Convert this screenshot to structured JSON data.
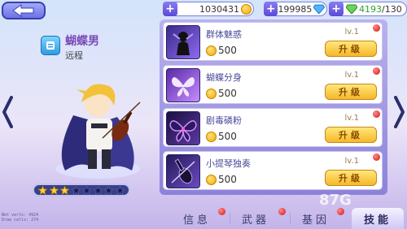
{
  "resources": {
    "coins": "1030431",
    "diamonds": "199985",
    "stamina": "4193",
    "stamina_max": "/130"
  },
  "hero": {
    "name": "蝴蝶男",
    "type": "远程",
    "stars_filled": 3,
    "stars_total": 8
  },
  "skills": [
    {
      "name": "群体魅惑",
      "cost": "500",
      "level": "lv.1",
      "button": "升级",
      "icon": "silhouette-icon"
    },
    {
      "name": "蝴蝶分身",
      "cost": "500",
      "level": "lv.1",
      "button": "升级",
      "icon": "butterfly-icon"
    },
    {
      "name": "剧毒磷粉",
      "cost": "500",
      "level": "lv.1",
      "button": "升级",
      "icon": "poison-butterfly-icon"
    },
    {
      "name": "小提琴独奏",
      "cost": "500",
      "level": "lv.1",
      "button": "升级",
      "icon": "violin-icon"
    }
  ],
  "tabs": [
    "信息",
    "武器",
    "基因",
    "技能"
  ],
  "active_tab": "技能",
  "debug": [
    "Net verts: 4924",
    "Draw calls: 274"
  ],
  "watermark": "87G"
}
